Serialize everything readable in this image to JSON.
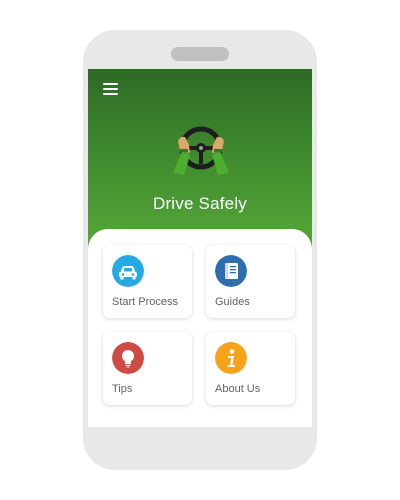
{
  "app": {
    "title": "Drive Safely"
  },
  "header": {
    "menu_icon": "hamburger-menu-icon",
    "logo_icon": "steering-wheel-hands-icon",
    "colors": {
      "top": "#2d6a25",
      "bottom": "#58ab3a"
    }
  },
  "menu": {
    "items": [
      {
        "label": "Start Process",
        "icon": "car-icon",
        "color": "#27a9e1"
      },
      {
        "label": "Guides",
        "icon": "book-icon",
        "color": "#2d6fae"
      },
      {
        "label": "Tips",
        "icon": "lightbulb-icon",
        "color": "#cf4a42"
      },
      {
        "label": "About Us",
        "icon": "info-icon",
        "color": "#f6a21b"
      }
    ]
  }
}
